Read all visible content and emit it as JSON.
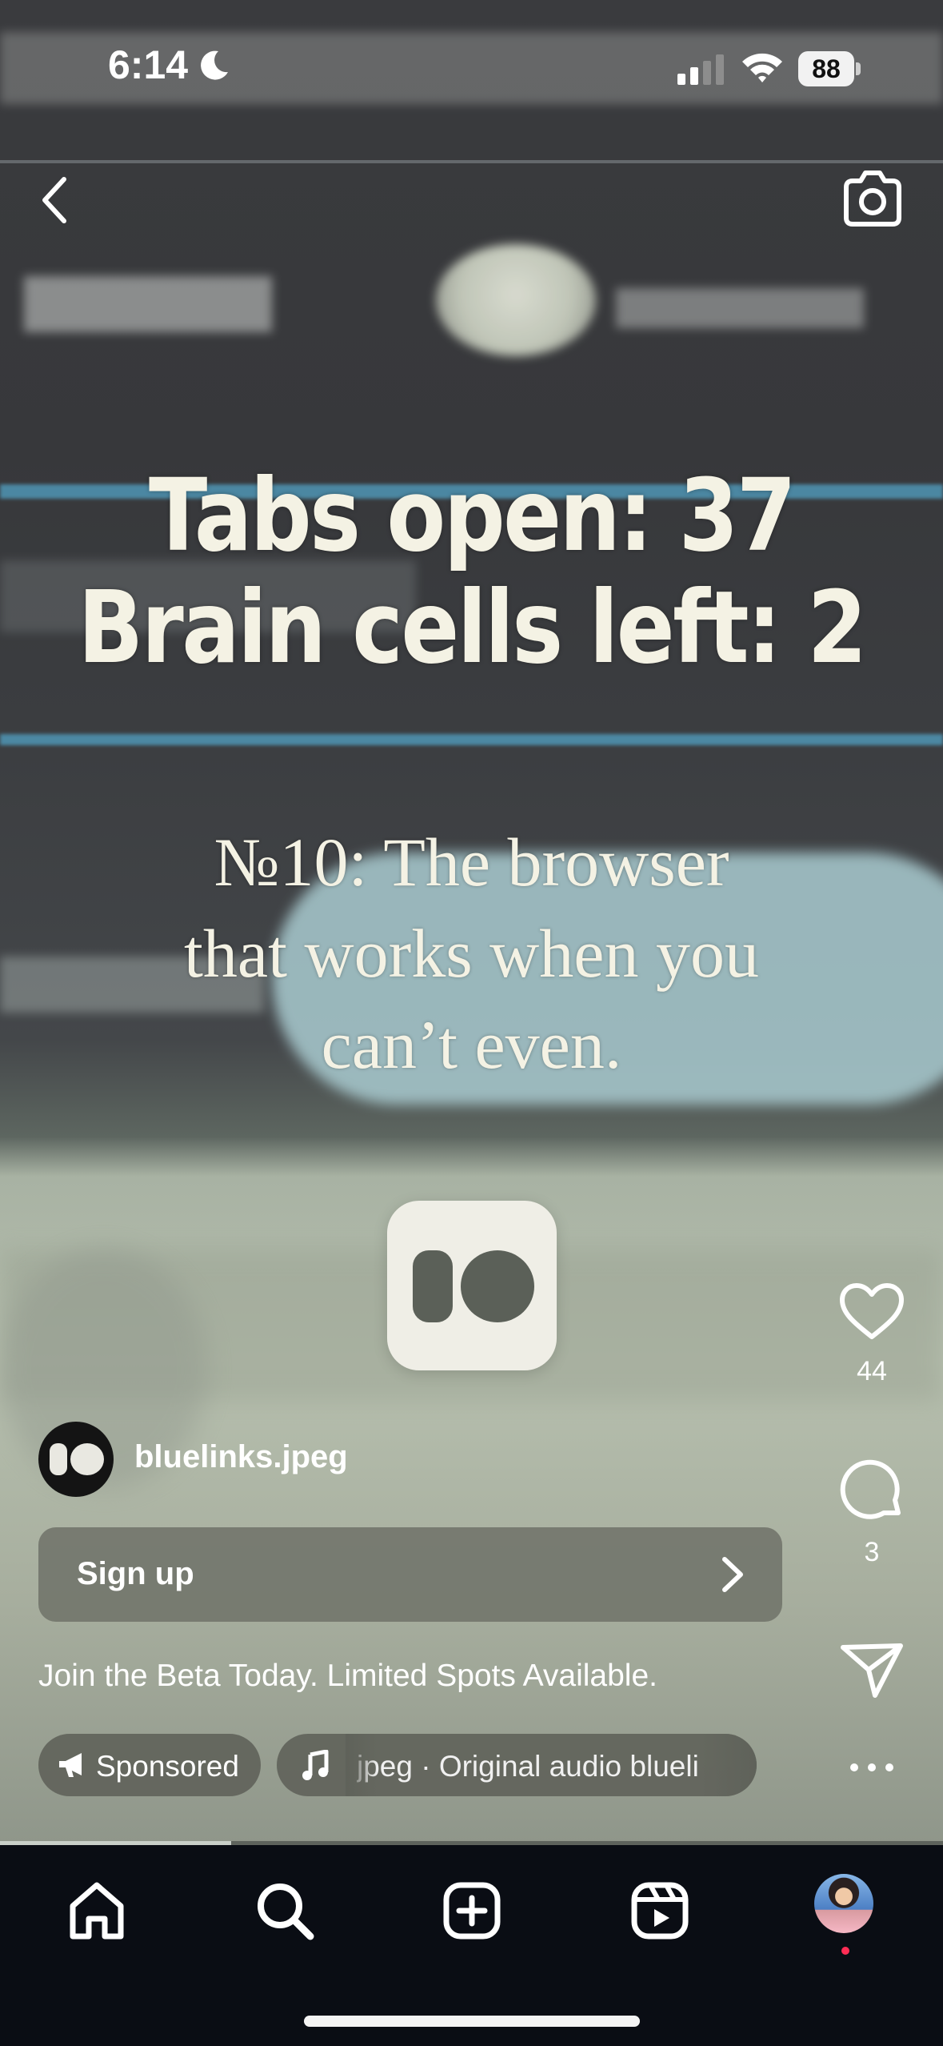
{
  "status_bar": {
    "time": "6:14",
    "battery": "88",
    "icons": [
      "moon-icon",
      "cellular-signal-icon",
      "wifi-icon",
      "battery-icon"
    ]
  },
  "top_bar": {
    "icons": [
      "chevron-left-icon",
      "camera-icon"
    ]
  },
  "video": {
    "headline_line1": "Tabs open: 37",
    "headline_line2": "Brain cells left: 2",
    "subline_line1": "№10: The browser",
    "subline_line2": "that works when you",
    "subline_line3": "can’t even.",
    "progress": 0.245
  },
  "actions": {
    "likes": "44",
    "comments": "3",
    "icons": [
      "heart-icon",
      "comment-icon",
      "share-icon",
      "more-icon"
    ]
  },
  "post": {
    "username": "bluelinks.jpeg",
    "cta_label": "Sign up",
    "caption": "Join the Beta Today. Limited Spots Available.",
    "sponsored_label": "Sponsored",
    "audio_label": "jpeg · Original audio    blueli"
  },
  "bottom_nav": {
    "items": [
      "home-icon",
      "search-icon",
      "create-icon",
      "reels-icon",
      "profile-avatar"
    ]
  },
  "colors": {
    "nav_background": "#0a0d14",
    "notification_dot": "#ff2d55",
    "headline_text": "#f4f2e4"
  }
}
